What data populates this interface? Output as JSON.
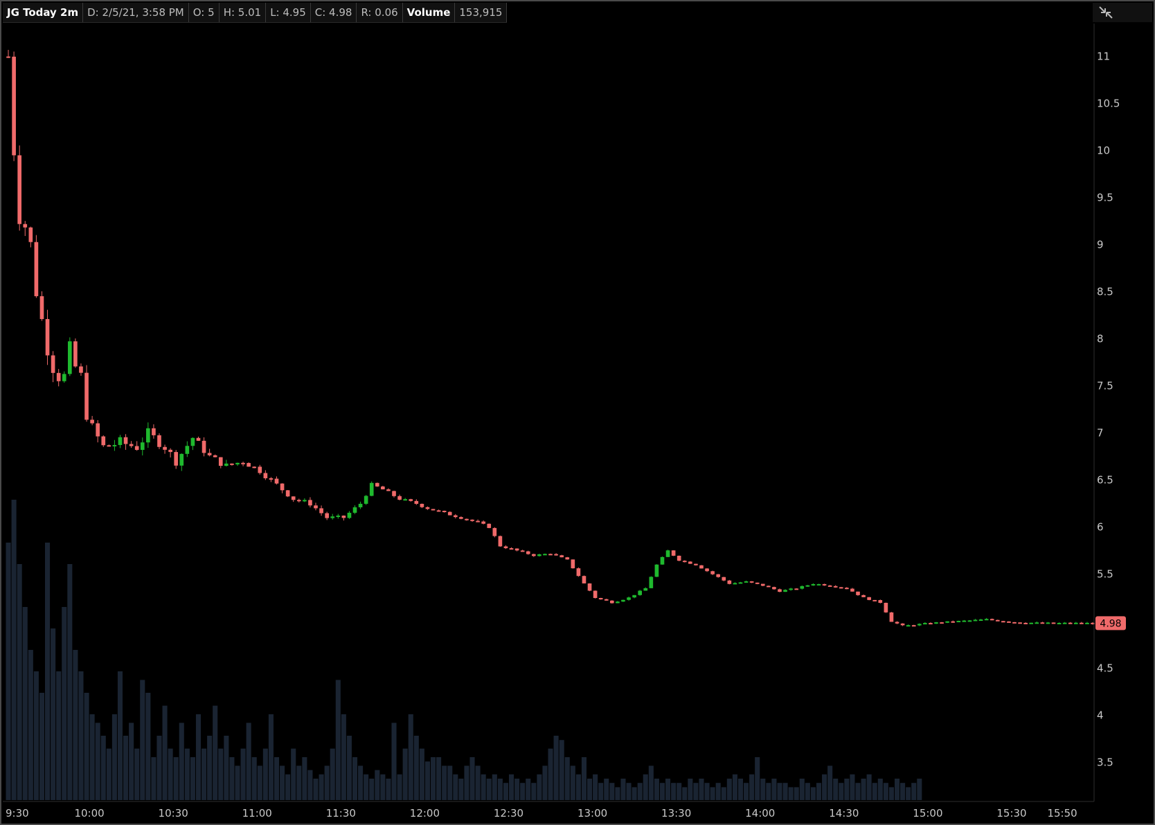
{
  "header": {
    "symbol": "JG Today 2m",
    "date": "D: 2/5/21, 3:58 PM",
    "open": "O: 5",
    "high": "H: 5.01",
    "low": "L: 4.95",
    "close": "C: 4.98",
    "range": "R: 0.06",
    "volume_label": "Volume",
    "volume_value": "153,915"
  },
  "icons": {
    "expand": "collapse-arrows-icon"
  },
  "last_price_label": "4.98",
  "colors": {
    "up": "#1fb92e",
    "down": "#f06a6a",
    "volume": "#1a2432",
    "background": "#000000",
    "last_price_bg": "#f06a6a"
  },
  "chart_data": {
    "type": "candlestick",
    "interval": "2m",
    "y_ticks": [
      "11",
      "10.5",
      "10",
      "9.5",
      "9",
      "8.5",
      "8",
      "7.5",
      "7",
      "6.5",
      "6",
      "5.5",
      "4.5",
      "4",
      "3.5"
    ],
    "x_ticks": [
      "9:30",
      "10:00",
      "10:30",
      "11:00",
      "11:30",
      "12:00",
      "12:30",
      "13:00",
      "13:30",
      "14:00",
      "14:30",
      "15:00",
      "15:30",
      "15:50"
    ],
    "ylim": [
      3.1,
      11.35
    ],
    "last_price": 4.98,
    "price_path": [
      [
        "9:30",
        11.0
      ],
      [
        "9:32",
        10.0
      ],
      [
        "9:34",
        9.3
      ],
      [
        "9:36",
        9.2
      ],
      [
        "9:38",
        9.0
      ],
      [
        "9:40",
        8.5
      ],
      [
        "9:42",
        8.2
      ],
      [
        "9:44",
        7.9
      ],
      [
        "9:46",
        7.7
      ],
      [
        "9:48",
        7.6
      ],
      [
        "9:50",
        7.6
      ],
      [
        "9:52",
        7.9
      ],
      [
        "9:54",
        7.7
      ],
      [
        "9:56",
        7.6
      ],
      [
        "9:58",
        7.2
      ],
      [
        "10:00",
        7.05
      ],
      [
        "10:04",
        6.85
      ],
      [
        "10:10",
        6.9
      ],
      [
        "10:16",
        6.85
      ],
      [
        "10:20",
        7.0
      ],
      [
        "10:26",
        6.85
      ],
      [
        "10:30",
        6.7
      ],
      [
        "10:36",
        6.95
      ],
      [
        "10:42",
        6.75
      ],
      [
        "10:48",
        6.65
      ],
      [
        "10:54",
        6.7
      ],
      [
        "11:00",
        6.6
      ],
      [
        "11:06",
        6.45
      ],
      [
        "11:12",
        6.3
      ],
      [
        "11:18",
        6.25
      ],
      [
        "11:24",
        6.1
      ],
      [
        "11:30",
        6.1
      ],
      [
        "11:36",
        6.25
      ],
      [
        "11:40",
        6.45
      ],
      [
        "11:44",
        6.4
      ],
      [
        "11:50",
        6.3
      ],
      [
        "11:56",
        6.25
      ],
      [
        "12:00",
        6.2
      ],
      [
        "12:06",
        6.15
      ],
      [
        "12:12",
        6.1
      ],
      [
        "12:18",
        6.05
      ],
      [
        "12:22",
        6.0
      ],
      [
        "12:26",
        5.8
      ],
      [
        "12:32",
        5.75
      ],
      [
        "12:38",
        5.7
      ],
      [
        "12:44",
        5.72
      ],
      [
        "12:50",
        5.65
      ],
      [
        "12:56",
        5.4
      ],
      [
        "13:00",
        5.25
      ],
      [
        "13:06",
        5.2
      ],
      [
        "13:12",
        5.25
      ],
      [
        "13:18",
        5.35
      ],
      [
        "13:22",
        5.6
      ],
      [
        "13:26",
        5.75
      ],
      [
        "13:30",
        5.65
      ],
      [
        "13:36",
        5.6
      ],
      [
        "13:42",
        5.5
      ],
      [
        "13:48",
        5.4
      ],
      [
        "13:54",
        5.42
      ],
      [
        "14:00",
        5.38
      ],
      [
        "14:06",
        5.32
      ],
      [
        "14:12",
        5.35
      ],
      [
        "14:18",
        5.4
      ],
      [
        "14:24",
        5.38
      ],
      [
        "14:30",
        5.35
      ],
      [
        "14:36",
        5.25
      ],
      [
        "14:42",
        5.2
      ],
      [
        "14:46",
        5.0
      ],
      [
        "14:50",
        4.95
      ],
      [
        "15:00",
        4.98
      ],
      [
        "15:10",
        5.0
      ],
      [
        "15:20",
        5.02
      ],
      [
        "15:30",
        4.99
      ],
      [
        "15:40",
        4.98
      ],
      [
        "15:50",
        4.98
      ],
      [
        "15:58",
        4.98
      ]
    ],
    "volume_relative": [
      0.6,
      0.7,
      0.55,
      0.45,
      0.35,
      0.3,
      0.25,
      0.6,
      0.4,
      0.3,
      0.45,
      0.55,
      0.35,
      0.3,
      0.25,
      0.2,
      0.18,
      0.15,
      0.12,
      0.2,
      0.3,
      0.15,
      0.18,
      0.12,
      0.28,
      0.25,
      0.1,
      0.15,
      0.22,
      0.12,
      0.1,
      0.18,
      0.12,
      0.1,
      0.2,
      0.12,
      0.15,
      0.22,
      0.12,
      0.15,
      0.1,
      0.08,
      0.12,
      0.18,
      0.1,
      0.08,
      0.12,
      0.2,
      0.1,
      0.08,
      0.06,
      0.12,
      0.08,
      0.1,
      0.07,
      0.05,
      0.06,
      0.08,
      0.12,
      0.28,
      0.2,
      0.15,
      0.1,
      0.08,
      0.06,
      0.05,
      0.07,
      0.06,
      0.05,
      0.18,
      0.06,
      0.12,
      0.2,
      0.15,
      0.12,
      0.09,
      0.1,
      0.1,
      0.08,
      0.08,
      0.06,
      0.05,
      0.08,
      0.1,
      0.08,
      0.06,
      0.05,
      0.06,
      0.05,
      0.04,
      0.06,
      0.05,
      0.04,
      0.05,
      0.04,
      0.06,
      0.08,
      0.12,
      0.15,
      0.14,
      0.1,
      0.08,
      0.06,
      0.1,
      0.05,
      0.06,
      0.04,
      0.05,
      0.04,
      0.03,
      0.05,
      0.04,
      0.03,
      0.04,
      0.06,
      0.08,
      0.05,
      0.04,
      0.05,
      0.04,
      0.04,
      0.03,
      0.05,
      0.04,
      0.05,
      0.04,
      0.03,
      0.04,
      0.03,
      0.05,
      0.06,
      0.05,
      0.04,
      0.06,
      0.1,
      0.05,
      0.04,
      0.05,
      0.04,
      0.04,
      0.03,
      0.03,
      0.05,
      0.04,
      0.03,
      0.04,
      0.06,
      0.08,
      0.05,
      0.04,
      0.05,
      0.06,
      0.04,
      0.05,
      0.06,
      0.04,
      0.05,
      0.04,
      0.03,
      0.05,
      0.04,
      0.03,
      0.04,
      0.05
    ]
  }
}
